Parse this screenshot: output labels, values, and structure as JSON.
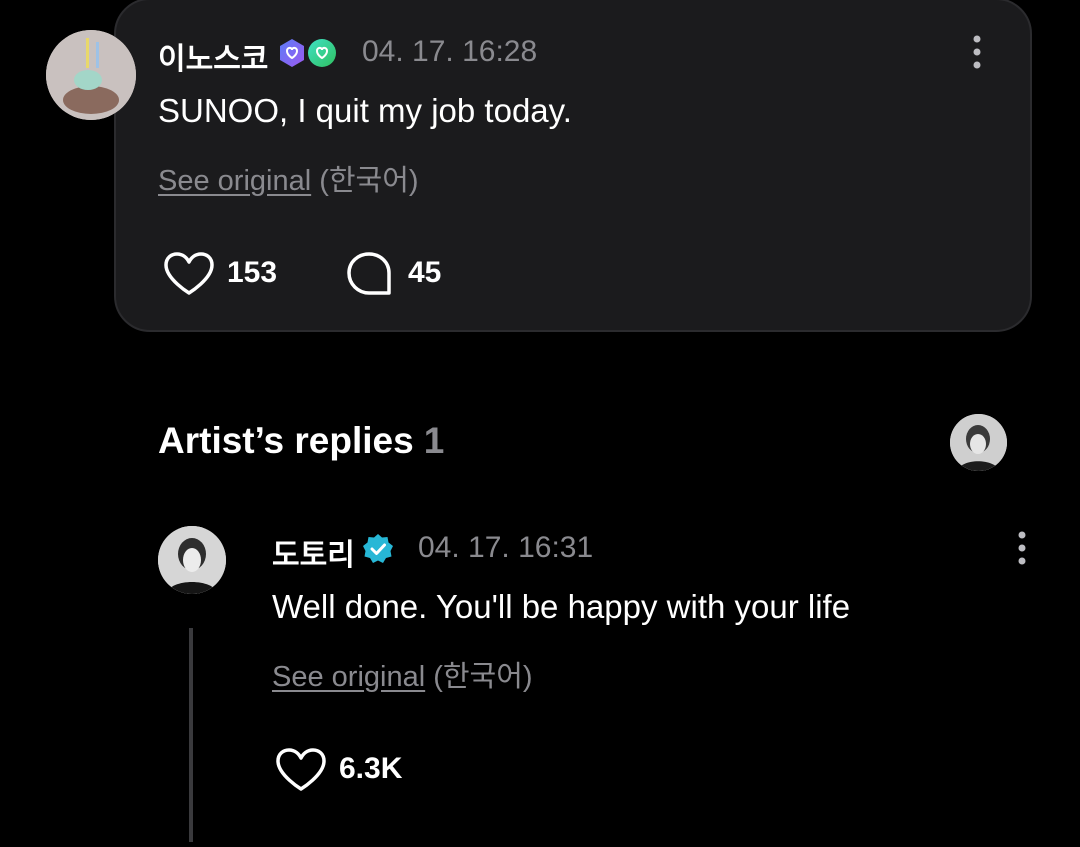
{
  "post": {
    "username": "이노스코",
    "timestamp": "04. 17. 16:28",
    "text": "SUNOO, I quit my job today.",
    "see_original": "See original",
    "language": "(한국어)",
    "like_count": "153",
    "comment_count": "45"
  },
  "replies_section": {
    "title": "Artist’s replies",
    "count": "1"
  },
  "reply": {
    "username": "도토리",
    "timestamp": "04. 17. 16:31",
    "text": "Well done. You'll be happy with your life",
    "see_original": "See original",
    "language": "(한국어)",
    "like_count": "6.3K"
  },
  "colors": {
    "background": "#000000",
    "card": "#1b1b1d",
    "muted": "#8a8a8f",
    "verified_badge": "#27b7d6"
  }
}
